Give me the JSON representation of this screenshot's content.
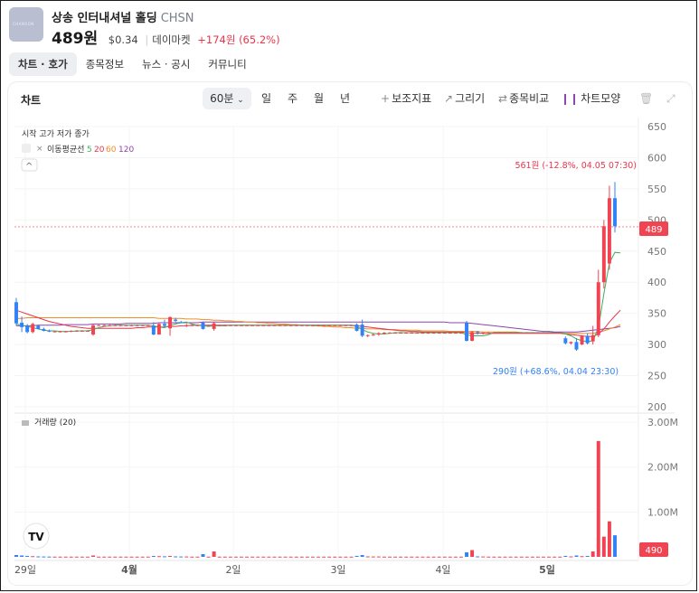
{
  "stock": {
    "logo_text": "CHANSON",
    "name": "상송 인터내셔널 홀딩",
    "ticker": "CHSN",
    "price": "489원",
    "usd": "$0.34",
    "market": "데이마켓",
    "change": "+174원 (65.2%)"
  },
  "tabs": [
    "차트 · 호가",
    "종목정보",
    "뉴스 · 공시",
    "커뮤니티"
  ],
  "toolbar": {
    "title": "차트",
    "interval": "60분",
    "periods": [
      "일",
      "주",
      "월",
      "년"
    ],
    "indicator": "보조지표",
    "draw": "그리기",
    "compare": "종목비교",
    "style": "차트모양"
  },
  "legend": {
    "ohlc": "시작 고가 저가 종가",
    "ma_label": "이동평균선",
    "ma_periods": [
      {
        "label": "5",
        "color": "#3cae5c"
      },
      {
        "label": "20",
        "color": "#e8364a"
      },
      {
        "label": "60",
        "color": "#f08c2a"
      },
      {
        "label": "120",
        "color": "#8e44ad"
      }
    ],
    "volume_label": "거래량 (20)"
  },
  "annotations": {
    "high": "561원 (-12.8%, 04.05 07:30)",
    "low": "290원 (+68.6%, 04.04 23:30)"
  },
  "colors": {
    "up": "#f04452",
    "down": "#3182f6"
  },
  "chart_data": {
    "type": "candlestick",
    "price_axis": {
      "ticks": [
        650,
        600,
        550,
        500,
        450,
        400,
        350,
        300,
        250,
        200
      ],
      "range": [
        200,
        650
      ]
    },
    "current_price_tag": "489",
    "volume_axis": {
      "ticks": [
        "3.00M",
        "2.00M",
        "1.00M"
      ],
      "range": [
        0,
        3000000
      ]
    },
    "current_volume_tag": "490",
    "x_labels": [
      "29일",
      "4월",
      "2일",
      "3일",
      "4일",
      "5일"
    ],
    "candles": [
      {
        "o": 368,
        "h": 375,
        "l": 330,
        "c": 334
      },
      {
        "o": 335,
        "h": 345,
        "l": 320,
        "c": 328
      },
      {
        "o": 330,
        "h": 333,
        "l": 318,
        "c": 320
      },
      {
        "o": 320,
        "h": 335,
        "l": 318,
        "c": 333
      },
      {
        "o": 330,
        "h": 332,
        "l": 324,
        "c": 325
      },
      {
        "o": 325,
        "h": 327,
        "l": 321,
        "c": 322
      },
      {
        "o": 322,
        "h": 324,
        "l": 320,
        "c": 321
      },
      {
        "o": 321,
        "h": 322,
        "l": 320,
        "c": 321
      },
      {
        "o": 321,
        "h": 322,
        "l": 320,
        "c": 321
      },
      {
        "o": 321,
        "h": 322,
        "l": 320,
        "c": 321
      },
      {
        "o": 321,
        "h": 323,
        "l": 320,
        "c": 322
      },
      {
        "o": 322,
        "h": 323,
        "l": 321,
        "c": 322
      },
      {
        "o": 322,
        "h": 323,
        "l": 321,
        "c": 322
      },
      {
        "o": 322,
        "h": 323,
        "l": 321,
        "c": 322
      },
      {
        "o": 316,
        "h": 332,
        "l": 314,
        "c": 331
      },
      {
        "o": 331,
        "h": 332,
        "l": 330,
        "c": 331
      },
      {
        "o": 331,
        "h": 332,
        "l": 330,
        "c": 331
      },
      {
        "o": 331,
        "h": 332,
        "l": 330,
        "c": 331
      },
      {
        "o": 331,
        "h": 332,
        "l": 330,
        "c": 331
      },
      {
        "o": 331,
        "h": 332,
        "l": 330,
        "c": 331
      },
      {
        "o": 331,
        "h": 332,
        "l": 330,
        "c": 331
      },
      {
        "o": 331,
        "h": 332,
        "l": 330,
        "c": 331
      },
      {
        "o": 331,
        "h": 332,
        "l": 330,
        "c": 331
      },
      {
        "o": 331,
        "h": 332,
        "l": 330,
        "c": 331
      },
      {
        "o": 331,
        "h": 332,
        "l": 330,
        "c": 331
      },
      {
        "o": 330,
        "h": 336,
        "l": 315,
        "c": 316
      },
      {
        "o": 316,
        "h": 334,
        "l": 316,
        "c": 333
      },
      {
        "o": 333,
        "h": 340,
        "l": 328,
        "c": 330
      },
      {
        "o": 326,
        "h": 345,
        "l": 314,
        "c": 344
      },
      {
        "o": 340,
        "h": 343,
        "l": 336,
        "c": 338
      },
      {
        "o": 336,
        "h": 338,
        "l": 334,
        "c": 335
      },
      {
        "o": 330,
        "h": 333,
        "l": 328,
        "c": 331
      },
      {
        "o": 331,
        "h": 332,
        "l": 330,
        "c": 331
      },
      {
        "o": 331,
        "h": 332,
        "l": 330,
        "c": 331
      },
      {
        "o": 335,
        "h": 337,
        "l": 324,
        "c": 325
      },
      {
        "o": 331,
        "h": 332,
        "l": 330,
        "c": 331
      },
      {
        "o": 325,
        "h": 336,
        "l": 322,
        "c": 334
      },
      {
        "o": 331,
        "h": 332,
        "l": 330,
        "c": 331
      },
      {
        "o": 331,
        "h": 332,
        "l": 330,
        "c": 331
      },
      {
        "o": 331,
        "h": 332,
        "l": 330,
        "c": 331
      },
      {
        "o": 331,
        "h": 332,
        "l": 330,
        "c": 331
      },
      {
        "o": 331,
        "h": 332,
        "l": 330,
        "c": 331
      },
      {
        "o": 331,
        "h": 332,
        "l": 330,
        "c": 331
      },
      {
        "o": 331,
        "h": 332,
        "l": 330,
        "c": 331
      },
      {
        "o": 331,
        "h": 332,
        "l": 330,
        "c": 331
      },
      {
        "o": 331,
        "h": 332,
        "l": 330,
        "c": 331
      },
      {
        "o": 331,
        "h": 332,
        "l": 330,
        "c": 331
      },
      {
        "o": 331,
        "h": 332,
        "l": 330,
        "c": 331
      },
      {
        "o": 331,
        "h": 332,
        "l": 330,
        "c": 331
      },
      {
        "o": 331,
        "h": 332,
        "l": 330,
        "c": 331
      },
      {
        "o": 331,
        "h": 332,
        "l": 330,
        "c": 331
      },
      {
        "o": 331,
        "h": 332,
        "l": 330,
        "c": 331
      },
      {
        "o": 331,
        "h": 332,
        "l": 330,
        "c": 331
      },
      {
        "o": 331,
        "h": 332,
        "l": 330,
        "c": 331
      },
      {
        "o": 331,
        "h": 332,
        "l": 330,
        "c": 331
      },
      {
        "o": 331,
        "h": 332,
        "l": 330,
        "c": 331
      },
      {
        "o": 331,
        "h": 332,
        "l": 330,
        "c": 331
      },
      {
        "o": 331,
        "h": 332,
        "l": 330,
        "c": 331
      },
      {
        "o": 331,
        "h": 332,
        "l": 330,
        "c": 331
      },
      {
        "o": 331,
        "h": 332,
        "l": 330,
        "c": 331
      },
      {
        "o": 331,
        "h": 332,
        "l": 330,
        "c": 331
      },
      {
        "o": 331,
        "h": 332,
        "l": 330,
        "c": 331
      },
      {
        "o": 332,
        "h": 334,
        "l": 321,
        "c": 322
      },
      {
        "o": 332,
        "h": 340,
        "l": 312,
        "c": 314
      },
      {
        "o": 314,
        "h": 316,
        "l": 312,
        "c": 315
      },
      {
        "o": 316,
        "h": 318,
        "l": 314,
        "c": 316
      },
      {
        "o": 316,
        "h": 320,
        "l": 314,
        "c": 318
      },
      {
        "o": 318,
        "h": 320,
        "l": 316,
        "c": 319
      },
      {
        "o": 319,
        "h": 320,
        "l": 318,
        "c": 319
      },
      {
        "o": 319,
        "h": 320,
        "l": 318,
        "c": 319
      },
      {
        "o": 319,
        "h": 320,
        "l": 318,
        "c": 319
      },
      {
        "o": 319,
        "h": 320,
        "l": 318,
        "c": 319
      },
      {
        "o": 319,
        "h": 320,
        "l": 318,
        "c": 319
      },
      {
        "o": 319,
        "h": 320,
        "l": 318,
        "c": 319
      },
      {
        "o": 319,
        "h": 320,
        "l": 318,
        "c": 319
      },
      {
        "o": 319,
        "h": 320,
        "l": 318,
        "c": 319
      },
      {
        "o": 319,
        "h": 320,
        "l": 318,
        "c": 319
      },
      {
        "o": 319,
        "h": 320,
        "l": 318,
        "c": 319
      },
      {
        "o": 319,
        "h": 320,
        "l": 318,
        "c": 319
      },
      {
        "o": 319,
        "h": 320,
        "l": 318,
        "c": 319
      },
      {
        "o": 319,
        "h": 320,
        "l": 318,
        "c": 319
      },
      {
        "o": 319,
        "h": 320,
        "l": 318,
        "c": 319
      },
      {
        "o": 335,
        "h": 338,
        "l": 305,
        "c": 306
      },
      {
        "o": 306,
        "h": 322,
        "l": 305,
        "c": 320
      },
      {
        "o": 320,
        "h": 322,
        "l": 316,
        "c": 318
      },
      {
        "o": 318,
        "h": 320,
        "l": 316,
        "c": 319
      },
      {
        "o": 319,
        "h": 320,
        "l": 318,
        "c": 319
      },
      {
        "o": 319,
        "h": 320,
        "l": 318,
        "c": 319
      },
      {
        "o": 319,
        "h": 320,
        "l": 318,
        "c": 319
      },
      {
        "o": 319,
        "h": 320,
        "l": 318,
        "c": 319
      },
      {
        "o": 319,
        "h": 320,
        "l": 318,
        "c": 319
      },
      {
        "o": 319,
        "h": 320,
        "l": 318,
        "c": 319
      },
      {
        "o": 319,
        "h": 320,
        "l": 318,
        "c": 319
      },
      {
        "o": 319,
        "h": 320,
        "l": 318,
        "c": 319
      },
      {
        "o": 319,
        "h": 320,
        "l": 318,
        "c": 319
      },
      {
        "o": 319,
        "h": 320,
        "l": 318,
        "c": 319
      },
      {
        "o": 319,
        "h": 320,
        "l": 318,
        "c": 319
      },
      {
        "o": 319,
        "h": 320,
        "l": 318,
        "c": 319
      },
      {
        "o": 319,
        "h": 320,
        "l": 318,
        "c": 319
      },
      {
        "o": 319,
        "h": 320,
        "l": 318,
        "c": 319
      },
      {
        "o": 310,
        "h": 313,
        "l": 300,
        "c": 302
      },
      {
        "o": 302,
        "h": 305,
        "l": 300,
        "c": 304
      },
      {
        "o": 304,
        "h": 310,
        "l": 290,
        "c": 292
      },
      {
        "o": 300,
        "h": 315,
        "l": 299,
        "c": 314
      },
      {
        "o": 314,
        "h": 318,
        "l": 300,
        "c": 302
      },
      {
        "o": 305,
        "h": 330,
        "l": 300,
        "c": 315
      },
      {
        "o": 315,
        "h": 420,
        "l": 312,
        "c": 400
      },
      {
        "o": 400,
        "h": 500,
        "l": 390,
        "c": 490
      },
      {
        "o": 430,
        "h": 555,
        "l": 420,
        "c": 535
      },
      {
        "o": 535,
        "h": 561,
        "l": 480,
        "c": 490
      }
    ],
    "volume": [
      40000,
      30000,
      20000,
      15000,
      10000,
      8000,
      6000,
      5000,
      5000,
      5000,
      5000,
      5000,
      5000,
      5000,
      30000,
      5000,
      5000,
      5000,
      5000,
      5000,
      5000,
      5000,
      5000,
      5000,
      5000,
      20000,
      15000,
      12000,
      20000,
      10000,
      8000,
      8000,
      5000,
      5000,
      60000,
      5000,
      120000,
      5000,
      5000,
      5000,
      5000,
      5000,
      5000,
      5000,
      5000,
      5000,
      5000,
      5000,
      5000,
      5000,
      5000,
      5000,
      5000,
      5000,
      5000,
      5000,
      5000,
      5000,
      5000,
      5000,
      5000,
      5000,
      20000,
      40000,
      10000,
      8000,
      8000,
      5000,
      5000,
      5000,
      5000,
      5000,
      5000,
      5000,
      5000,
      5000,
      5000,
      5000,
      5000,
      5000,
      5000,
      5000,
      100000,
      150000,
      10000,
      8000,
      5000,
      5000,
      5000,
      5000,
      5000,
      5000,
      5000,
      5000,
      5000,
      5000,
      5000,
      5000,
      5000,
      5000,
      20000,
      10000,
      30000,
      15000,
      20000,
      120000,
      2580000,
      450000,
      790000,
      480000
    ],
    "ma5": [
      333,
      331,
      329,
      327,
      325,
      323,
      322,
      322,
      321,
      321,
      321,
      322,
      322,
      322,
      324,
      327,
      329,
      330,
      331,
      331,
      331,
      331,
      331,
      331,
      331,
      330,
      328,
      327,
      331,
      333,
      335,
      336,
      333,
      331,
      330,
      329,
      330,
      330,
      330,
      331,
      331,
      331,
      331,
      331,
      331,
      331,
      331,
      331,
      331,
      331,
      331,
      331,
      331,
      331,
      331,
      331,
      331,
      331,
      331,
      331,
      331,
      331,
      329,
      324,
      320,
      318,
      317,
      317,
      318,
      319,
      319,
      319,
      319,
      319,
      319,
      319,
      319,
      319,
      319,
      319,
      319,
      319,
      316,
      314,
      314,
      314,
      316,
      319,
      319,
      319,
      319,
      319,
      319,
      319,
      319,
      319,
      319,
      319,
      319,
      319,
      317,
      314,
      309,
      306,
      305,
      306,
      327,
      382,
      431,
      448,
      447
    ],
    "ma20": [
      355,
      352,
      349,
      346,
      343,
      340,
      337,
      335,
      333,
      331,
      329,
      328,
      327,
      326,
      326,
      326,
      326,
      326,
      326,
      326,
      326,
      326,
      327,
      327,
      328,
      328,
      328,
      328,
      329,
      329,
      330,
      330,
      331,
      331,
      331,
      331,
      331,
      331,
      331,
      331,
      331,
      331,
      331,
      331,
      331,
      331,
      331,
      331,
      331,
      331,
      331,
      331,
      331,
      331,
      331,
      331,
      331,
      331,
      331,
      331,
      331,
      331,
      330,
      329,
      328,
      327,
      326,
      325,
      324,
      323,
      322,
      322,
      321,
      321,
      320,
      320,
      320,
      320,
      320,
      320,
      320,
      320,
      319,
      318,
      318,
      318,
      318,
      318,
      318,
      318,
      318,
      318,
      318,
      318,
      318,
      318,
      318,
      318,
      318,
      318,
      317,
      316,
      315,
      314,
      313,
      313,
      317,
      325,
      336,
      346,
      355
    ],
    "ma60": [
      342,
      342,
      343,
      343,
      343,
      343,
      343,
      343,
      343,
      343,
      343,
      343,
      343,
      343,
      343,
      343,
      343,
      343,
      343,
      343,
      343,
      343,
      343,
      343,
      343,
      343,
      342,
      342,
      342,
      342,
      342,
      341,
      341,
      341,
      340,
      340,
      339,
      339,
      338,
      338,
      337,
      337,
      336,
      336,
      335,
      335,
      334,
      334,
      333,
      333,
      332,
      332,
      331,
      331,
      330,
      330,
      329,
      329,
      328,
      328,
      327,
      327,
      326,
      326,
      325,
      325,
      325,
      324,
      324,
      324,
      323,
      323,
      323,
      323,
      322,
      322,
      322,
      322,
      322,
      321,
      321,
      321,
      321,
      321,
      321,
      320,
      320,
      320,
      320,
      320,
      320,
      320,
      319,
      319,
      319,
      319,
      319,
      319,
      319,
      319,
      318,
      318,
      318,
      318,
      318,
      318,
      320,
      322,
      325,
      328,
      332
    ],
    "ma120": [
      330,
      330,
      330,
      330,
      331,
      331,
      331,
      331,
      331,
      332,
      332,
      332,
      332,
      332,
      333,
      333,
      333,
      333,
      333,
      333,
      334,
      334,
      334,
      334,
      334,
      334,
      335,
      335,
      335,
      335,
      335,
      335,
      335,
      335,
      336,
      336,
      336,
      336,
      336,
      336,
      336,
      336,
      336,
      336,
      336,
      336,
      336,
      336,
      336,
      336,
      336,
      336,
      336,
      336,
      336,
      336,
      336,
      336,
      336,
      336,
      336,
      336,
      336,
      336,
      336,
      336,
      336,
      336,
      336,
      336,
      336,
      336,
      336,
      336,
      336,
      336,
      336,
      336,
      336,
      335,
      335,
      335,
      335,
      334,
      333,
      332,
      331,
      330,
      329,
      328,
      327,
      326,
      325,
      324,
      323,
      322,
      321,
      321,
      320,
      320,
      320,
      320,
      320,
      321,
      322,
      323,
      324,
      325,
      326,
      327,
      329
    ]
  }
}
